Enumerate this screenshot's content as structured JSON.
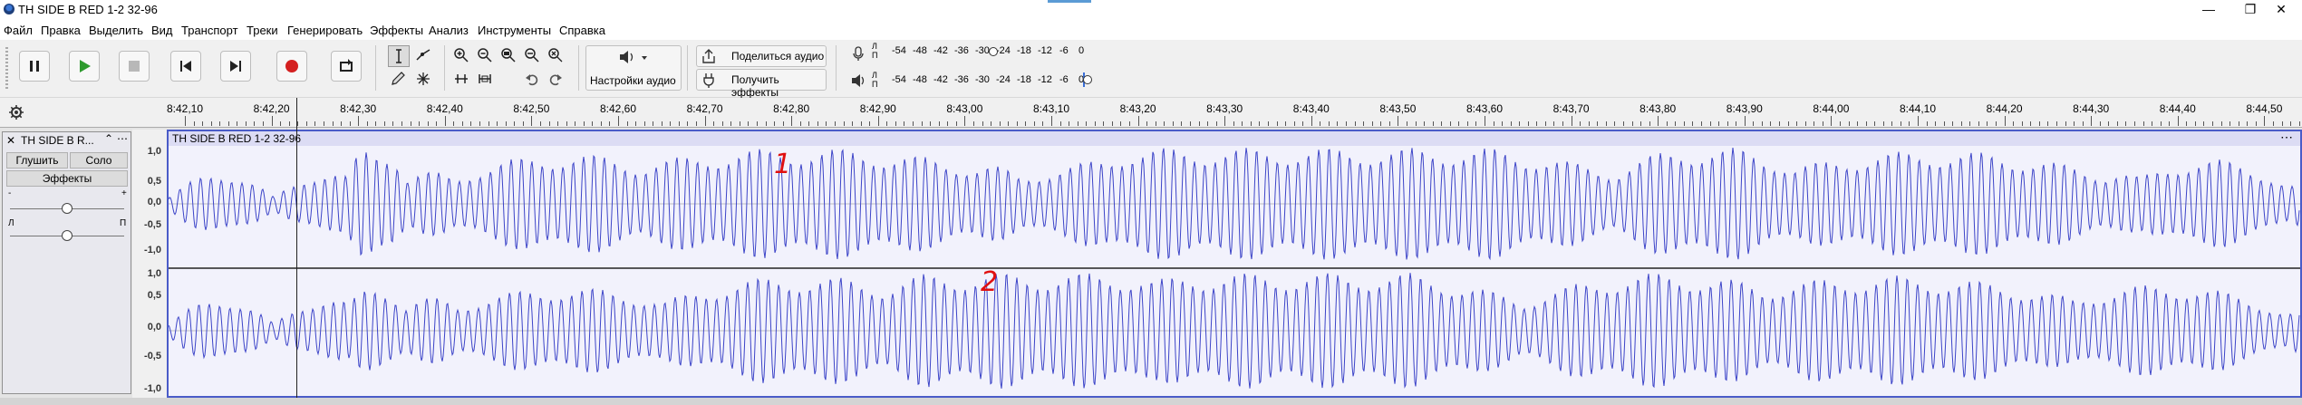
{
  "window": {
    "title": "TH SIDE B RED 1-2 32-96",
    "minimize": "—",
    "maximize": "❐",
    "close": "✕"
  },
  "menu": [
    "Файл",
    "Правка",
    "Выделить",
    "Вид",
    "Транспорт",
    "Треки",
    "Генерировать",
    "Эффекты",
    "Анализ",
    "Инструменты",
    "Справка"
  ],
  "toolbar": {
    "audio_setup_label": "Настройки аудио",
    "share_audio_label": "Поделиться аудио",
    "get_effects_label": "Получить эффекты",
    "meter_record": {
      "l": "Л",
      "r": "П",
      "ticks": [
        "-54",
        "-48",
        "-42",
        "-36",
        "-30",
        "-24",
        "-18",
        "-12",
        "-6",
        "0"
      ]
    },
    "meter_play": {
      "l": "Л",
      "r": "П",
      "ticks": [
        "-54",
        "-48",
        "-42",
        "-36",
        "-30",
        "-24",
        "-18",
        "-12",
        "-6",
        "0"
      ]
    }
  },
  "ruler": {
    "labels": [
      "8:42,10",
      "8:42,20",
      "8:42,30",
      "8:42,40",
      "8:42,50",
      "8:42,60",
      "8:42,70",
      "8:42,80",
      "8:42,90",
      "8:43,00",
      "8:43,10",
      "8:43,20",
      "8:43,30",
      "8:43,40",
      "8:43,50",
      "8:43,60",
      "8:43,70",
      "8:43,80",
      "8:43,90",
      "8:44,00",
      "8:44,10",
      "8:44,20",
      "8:44,30",
      "8:44,40",
      "8:44,50"
    ]
  },
  "track": {
    "name": "TH SIDE B R...",
    "mute_label": "Глушить",
    "solo_label": "Соло",
    "effects_label": "Эффекты",
    "gain_minus": "-",
    "gain_plus": "+",
    "pan_left": "Л",
    "pan_right": "П",
    "gain_level": 0.5,
    "pan_level": 0.5,
    "clip_name": "TH SIDE B RED 1-2 32-96",
    "channel_annotations": [
      "1",
      "2"
    ],
    "amplitude_labels": [
      "1,0",
      "0,5",
      "0,0",
      "-0,5",
      "-1,0"
    ]
  },
  "colors": {
    "waveform": "#3c44c8",
    "wave_bg": "#f2f2fc",
    "selection_border": "#4a5cc8",
    "annotation": "#e01010",
    "play_green": "#2e9a2e",
    "record_red": "#d42020"
  }
}
